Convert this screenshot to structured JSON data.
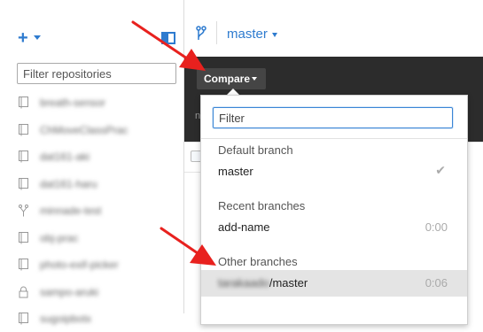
{
  "sidebar": {
    "filter_placeholder": "Filter repositories",
    "repos": [
      {
        "name": "breath-sensor",
        "icon": "repo-icon"
      },
      {
        "name": "ChMoveClassPrac",
        "icon": "repo-icon"
      },
      {
        "name": "dat161-aki",
        "icon": "repo-icon"
      },
      {
        "name": "dat161-haru",
        "icon": "repo-icon"
      },
      {
        "name": "minnade-test",
        "icon": "fork-icon"
      },
      {
        "name": "obj-prac",
        "icon": "repo-icon"
      },
      {
        "name": "photo-exif-picker",
        "icon": "repo-icon"
      },
      {
        "name": "sampo-aruki",
        "icon": "lock-icon"
      },
      {
        "name": "sugoipbotx",
        "icon": "repo-icon"
      }
    ]
  },
  "header": {
    "branch": "master"
  },
  "compare": {
    "button_label": "Compare",
    "dark_stub": "n"
  },
  "dropdown": {
    "filter_placeholder": "Filter",
    "default_header": "Default branch",
    "default_branch": "master",
    "recent_header": "Recent branches",
    "recent": [
      {
        "name": "add-name",
        "time": "0:00"
      }
    ],
    "other_header": "Other branches",
    "other": [
      {
        "prefix": "tarakaado",
        "suffix": "/master",
        "time": "0:06"
      }
    ]
  },
  "colors": {
    "accent": "#2e7bcf",
    "dark_bar": "#2c2c2c",
    "arrow": "#e8211e"
  }
}
